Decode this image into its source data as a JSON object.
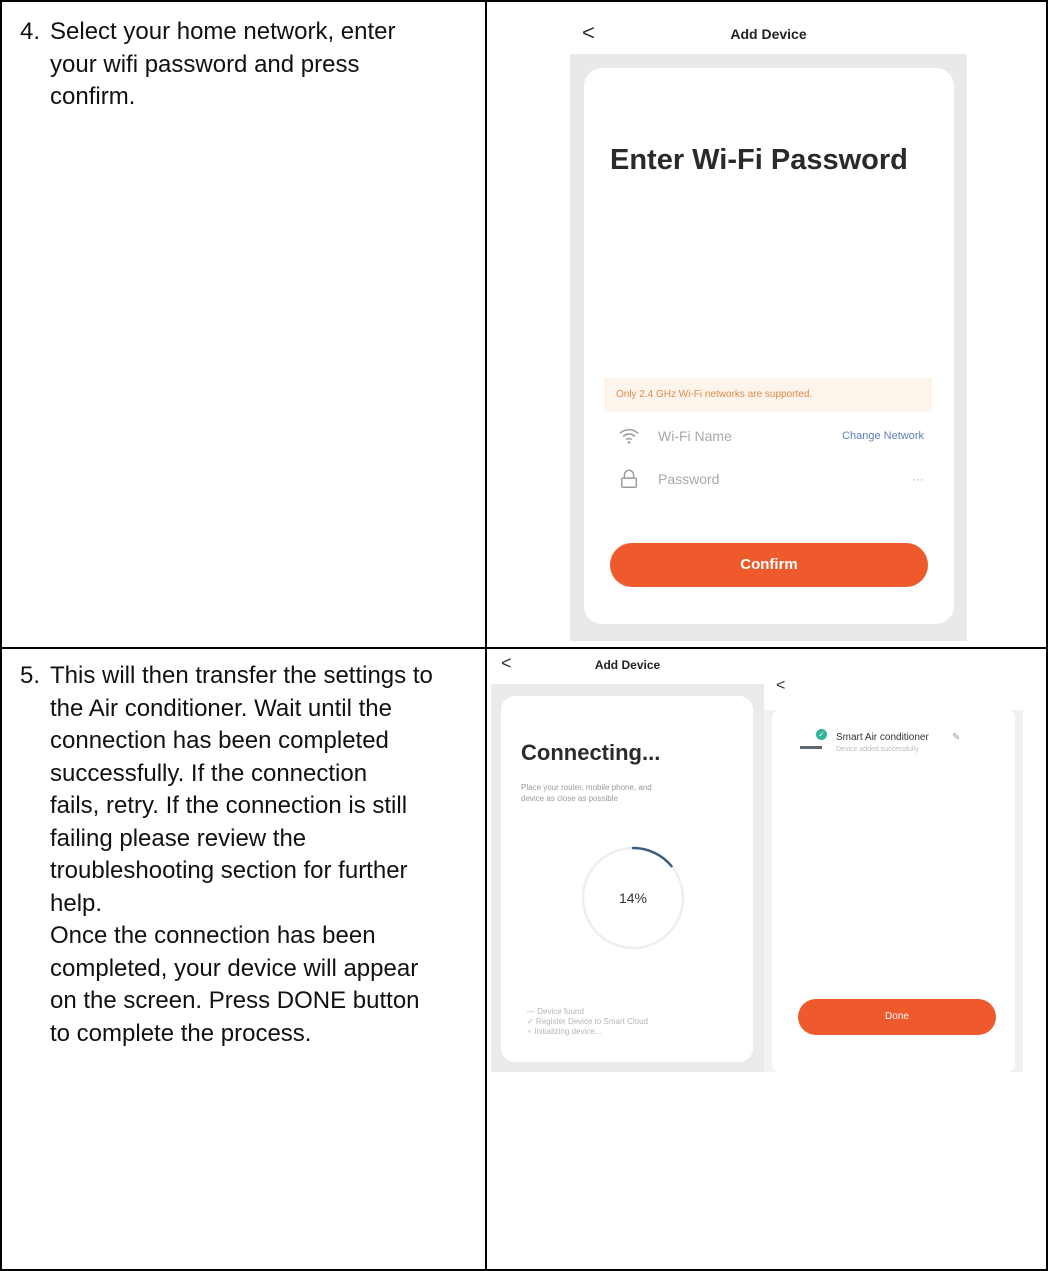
{
  "step4": {
    "number": "4.",
    "lines": [
      "Select your home network, enter",
      "your wifi password and press",
      "confirm."
    ]
  },
  "step5": {
    "number": "5.",
    "lines": [
      "This will then transfer the settings to",
      "the Air conditioner. Wait until the",
      "connection has been completed",
      "successfully. If the connection",
      "fails, retry. If the connection is still",
      "failing please review the",
      "troubleshooting section for further",
      "help.",
      "Once the connection has been",
      "completed, your device will appear",
      "on the screen. Press DONE button",
      "to complete the process."
    ]
  },
  "wifi_screen": {
    "back": "<",
    "title": "Add Device",
    "heading": "Enter Wi-Fi Password",
    "notice": "Only 2.4 GHz Wi-Fi networks are supported.",
    "wifi_label": "Wi-Fi Name",
    "change_network": "Change Network",
    "password_label": "Password",
    "password_toggle": "···",
    "confirm": "Confirm",
    "colors": {
      "accent": "#ee5a2c",
      "backdrop": "#e9e9e9",
      "notice_bg": "#fdf5ec"
    }
  },
  "connecting_screen": {
    "back": "<",
    "title": "Add Device",
    "heading": "Connecting...",
    "subtitle_line1": "Place your router, mobile phone, and",
    "subtitle_line2": "device as close as possible",
    "progress_label": "14%",
    "progress": 0.14,
    "checklist": [
      "— Device found",
      "✓ Register Device to Smart Cloud",
      "∘ Initializing device..."
    ]
  },
  "done_screen": {
    "back": "<",
    "device_name": "Smart Air conditioner",
    "device_status": "Device added successfully",
    "done": "Done"
  }
}
